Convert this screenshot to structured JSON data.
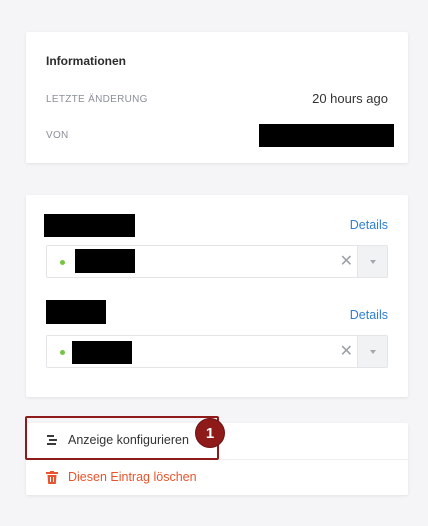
{
  "info": {
    "title": "Informationen",
    "last_changed_label": "LETZTE ÄNDERUNG",
    "last_changed_value": "20 hours ago",
    "by_label": "VON"
  },
  "relations": [
    {
      "details_label": "Details"
    },
    {
      "details_label": "Details"
    }
  ],
  "actions": {
    "configure_label": "Anzeige konfigurieren",
    "delete_label": "Diesen Eintrag löschen"
  },
  "annotation": {
    "badge_number": "1"
  },
  "colors": {
    "accent_link": "#2f7fd1",
    "danger": "#e8542c",
    "status_dot": "#74c441",
    "annotation": "#8e1a1a"
  }
}
